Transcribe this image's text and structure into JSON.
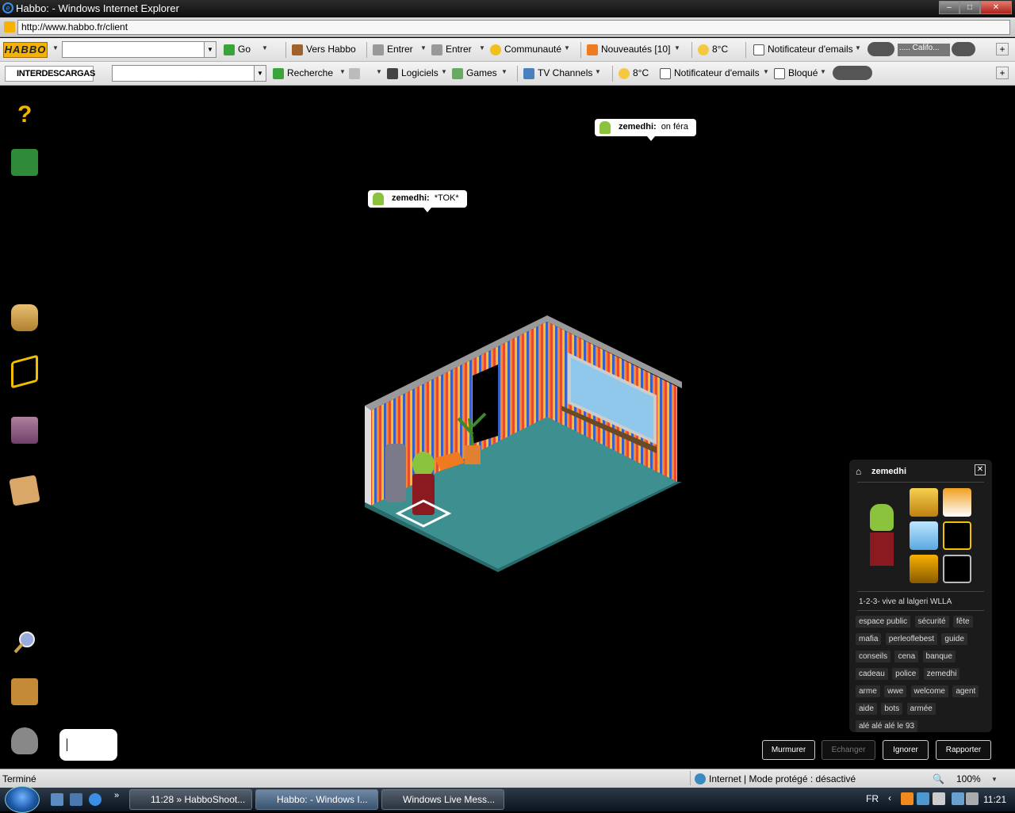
{
  "window": {
    "title": "Habbo: - Windows Internet Explorer",
    "minimize": "–",
    "maximize": "□",
    "close": "✕"
  },
  "address": {
    "url": "http://www.habbo.fr/client"
  },
  "toolbar1": {
    "logo": "HABBO",
    "go": "Go",
    "vers_habbo": "Vers Habbo",
    "entrer1": "Entrer",
    "entrer2": "Entrer",
    "communaute": "Communauté",
    "nouveautes": "Nouveautés",
    "nouveautes_count": "[10]",
    "weather": "8°C",
    "notificateur": "Notificateur d'emails",
    "radio": "..... Califo..."
  },
  "toolbar2": {
    "logo": "INTERDESCARGAS",
    "recherche": "Recherche",
    "logiciels": "Logiciels",
    "games": "Games",
    "tv": "TV Channels",
    "weather": "8°C",
    "notificateur": "Notificateur d'emails",
    "bloque": "Bloqué"
  },
  "chat": [
    {
      "user": "zemedhi:",
      "text": "on féra"
    },
    {
      "user": "zemedhi:",
      "text": "*TOK*"
    }
  ],
  "info_panel": {
    "name": "zemedhi",
    "motto": "1-2-3- vive al lalgeri WLLA",
    "tags": [
      "espace public",
      "sécurité",
      "fête",
      "mafia",
      "perleoflebest",
      "guide",
      "conseils",
      "cena",
      "banque",
      "cadeau",
      "police",
      "zemedhi",
      "arme",
      "wwe",
      "welcome",
      "agent",
      "aide",
      "bots",
      "armée",
      "alé alé alé le 93"
    ],
    "badges": [
      "gold-crown-badge",
      "flaming-skull-badge",
      "hc-badge",
      "crystal-badge",
      "hc-level-badge",
      "vip-badge"
    ]
  },
  "actions": {
    "whisper": "Murmurer",
    "trade": "Echanger",
    "ignore": "Ignorer",
    "report": "Rapporter"
  },
  "statusbar": {
    "left": "Terminé",
    "zone": "Internet | Mode protégé : désactivé",
    "zoom": "100%"
  },
  "taskbar": {
    "tasks": [
      "11:28 » HabboShoot...",
      "Habbo: - Windows I...",
      "Windows Live Mess..."
    ],
    "lang": "FR",
    "time": "11:21"
  },
  "colors": {
    "habbo_yellow": "#f6b200",
    "room_floor": "#3d8c8c",
    "panel_bg": "#1b1b1b"
  }
}
